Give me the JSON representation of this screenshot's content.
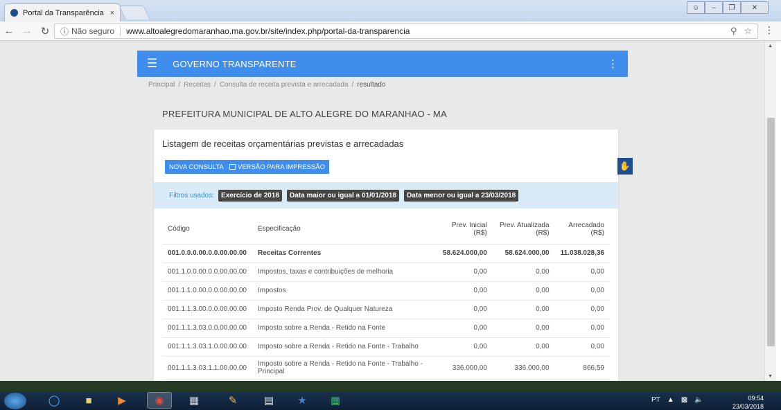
{
  "browser": {
    "tab_title": "Portal da Transparência",
    "tab_close": "×",
    "security_label": "Não seguro",
    "url": "www.altoalegredomaranhao.ma.gov.br/site/index.php/portal-da-transparencia"
  },
  "appbar": {
    "brand": "GOVERNO TRANSPARENTE"
  },
  "breadcrumb": {
    "items": [
      "Principal",
      "Receitas",
      "Consulta de receita prevista e arrecadada"
    ],
    "current": "resultado"
  },
  "page_title": "PREFEITURA MUNICIPAL DE ALTO ALEGRE DO MARANHAO - MA",
  "card": {
    "heading": "Listagem de receitas orçamentárias previstas e arrecadadas",
    "new_query_label": "NOVA CONSULTA",
    "print_label": "VERSÃO PARA IMPRESSÃO",
    "filters_label": "Filtros usados:",
    "filters": [
      "Exercício de 2018",
      "Data maior ou igual a 01/01/2018",
      "Data menor ou igual a 23/03/2018"
    ]
  },
  "table": {
    "headers": {
      "code": "Código",
      "spec": "Especificação",
      "prev_initial_1": "Prev. Inicial",
      "prev_initial_2": "(R$)",
      "prev_updated_1": "Prev. Atualizada",
      "prev_updated_2": "(R$)",
      "collected_1": "Arrecadado",
      "collected_2": "(R$)"
    },
    "rows": [
      {
        "code": "001.0.0.0.00.0.0.00.00.00",
        "spec": "Receitas Correntes",
        "prev_initial": "58.624.000,00",
        "prev_updated": "58.624.000,00",
        "collected": "11.038.028,36"
      },
      {
        "code": "001.1.0.0.00.0.0.00.00.00",
        "spec": "Impostos, taxas e contribuições de melhoria",
        "prev_initial": "0,00",
        "prev_updated": "0,00",
        "collected": "0,00"
      },
      {
        "code": "001.1.1.0.00.0.0.00.00.00",
        "spec": "Impostos",
        "prev_initial": "0,00",
        "prev_updated": "0,00",
        "collected": "0,00"
      },
      {
        "code": "001.1.1.3.00.0.0.00.00.00",
        "spec": "Imposto Renda Prov. de Qualquer Natureza",
        "prev_initial": "0,00",
        "prev_updated": "0,00",
        "collected": "0,00"
      },
      {
        "code": "001.1.1.3.03.0.0.00.00.00",
        "spec": "Imposto sobre a Renda - Retido na Fonte",
        "prev_initial": "0,00",
        "prev_updated": "0,00",
        "collected": "0,00"
      },
      {
        "code": "001.1.1.3.03.1.0.00.00.00",
        "spec": "Imposto sobre a Renda - Retido na Fonte - Trabalho",
        "prev_initial": "0,00",
        "prev_updated": "0,00",
        "collected": "0,00"
      },
      {
        "code": "001.1.1.3.03.1.1.00.00.00",
        "spec": "Imposto sobre a Renda - Retido na Fonte - Trabalho - Principal",
        "prev_initial": "336.000,00",
        "prev_updated": "336.000,00",
        "collected": "866,59"
      }
    ]
  },
  "taskbar": {
    "language": "PT",
    "time": "09:54",
    "date": "23/03/2018"
  }
}
